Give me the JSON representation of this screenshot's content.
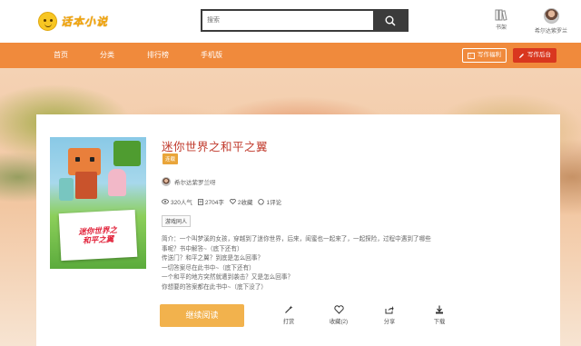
{
  "header": {
    "logo_text": "话本小说",
    "search_placeholder": "搜索",
    "shelf_label": "书架",
    "username": "希尔达紫罗兰"
  },
  "nav": {
    "items": [
      "首页",
      "分类",
      "排行榜",
      "手机版"
    ],
    "write_label": "写作福利",
    "backend_label": "写作后台"
  },
  "book": {
    "cover_caption_line1": "迷你世界之",
    "cover_caption_line2": "和平之翼",
    "title": "迷你世界之和平之翼",
    "status": "连载",
    "author": "希尔达紫罗兰呀",
    "popularity": "320人气",
    "word_count": "2704字",
    "favorites": "2收藏",
    "comments": "1评论",
    "genre": "游戏同人",
    "intro": [
      "简介：一个叫梦溪的女孩，穿越到了迷你世界，后来，闺蜜也一起来了，一起探险，过程中遇到了哪些",
      "事呢？书中解答~（底下还有）",
      "传送门？和平之翼？到底是怎么回事？",
      "一切答案尽在此书中~（底下还有）",
      "一个和平的地方突然就遭到袭击？又是怎么回事？",
      "你想要的答案都在此书中~（底下没了）"
    ]
  },
  "actions": {
    "read_label": "继续阅读",
    "reward_label": "打赏",
    "collect_label": "收藏(2)",
    "share_label": "分享",
    "download_label": "下载"
  },
  "colors": {
    "nav_bg": "#f08a3c",
    "title": "#c0392b",
    "read_button": "#f2b24d",
    "backend_button": "#d9371f"
  }
}
